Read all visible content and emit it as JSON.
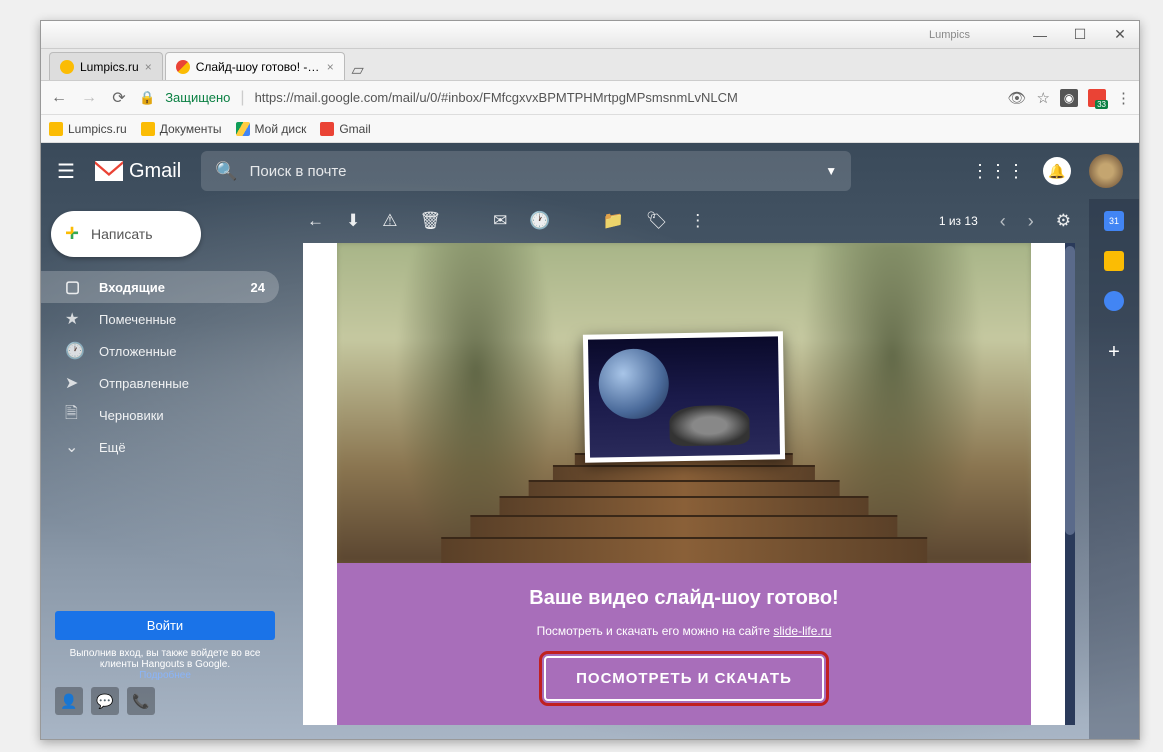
{
  "window": {
    "app_label": "Lumpics"
  },
  "tabs": [
    {
      "title": "Lumpics.ru"
    },
    {
      "title": "Слайд-шоу готово! - lum"
    }
  ],
  "address_bar": {
    "secure_label": "Защищено",
    "url": "https://mail.google.com/mail/u/0/#inbox/FMfcgxvxBPMTPHMrtpgMPsmsnmLvNLCM",
    "badge": "33"
  },
  "bookmarks": [
    {
      "label": "Lumpics.ru"
    },
    {
      "label": "Документы"
    },
    {
      "label": "Мой диск"
    },
    {
      "label": "Gmail"
    }
  ],
  "gmail": {
    "logo_text": "Gmail",
    "search_placeholder": "Поиск в почте",
    "compose_label": "Написать",
    "nav": [
      {
        "label": "Входящие",
        "count": "24"
      },
      {
        "label": "Помеченные"
      },
      {
        "label": "Отложенные"
      },
      {
        "label": "Отправленные"
      },
      {
        "label": "Черновики"
      },
      {
        "label": "Ещё"
      }
    ],
    "pagination": "1 из 13",
    "hangouts": {
      "signin": "Войти",
      "text": "Выполнив вход, вы также войдете во все клиенты Hangouts в Google.",
      "more": "Подробнее"
    }
  },
  "email": {
    "title": "Ваше видео слайд-шоу готово!",
    "subtitle_prefix": "Посмотреть и скачать его можно на сайте ",
    "subtitle_link": "slide-life.ru",
    "cta": "ПОСМОТРЕТЬ И СКАЧАТЬ"
  }
}
